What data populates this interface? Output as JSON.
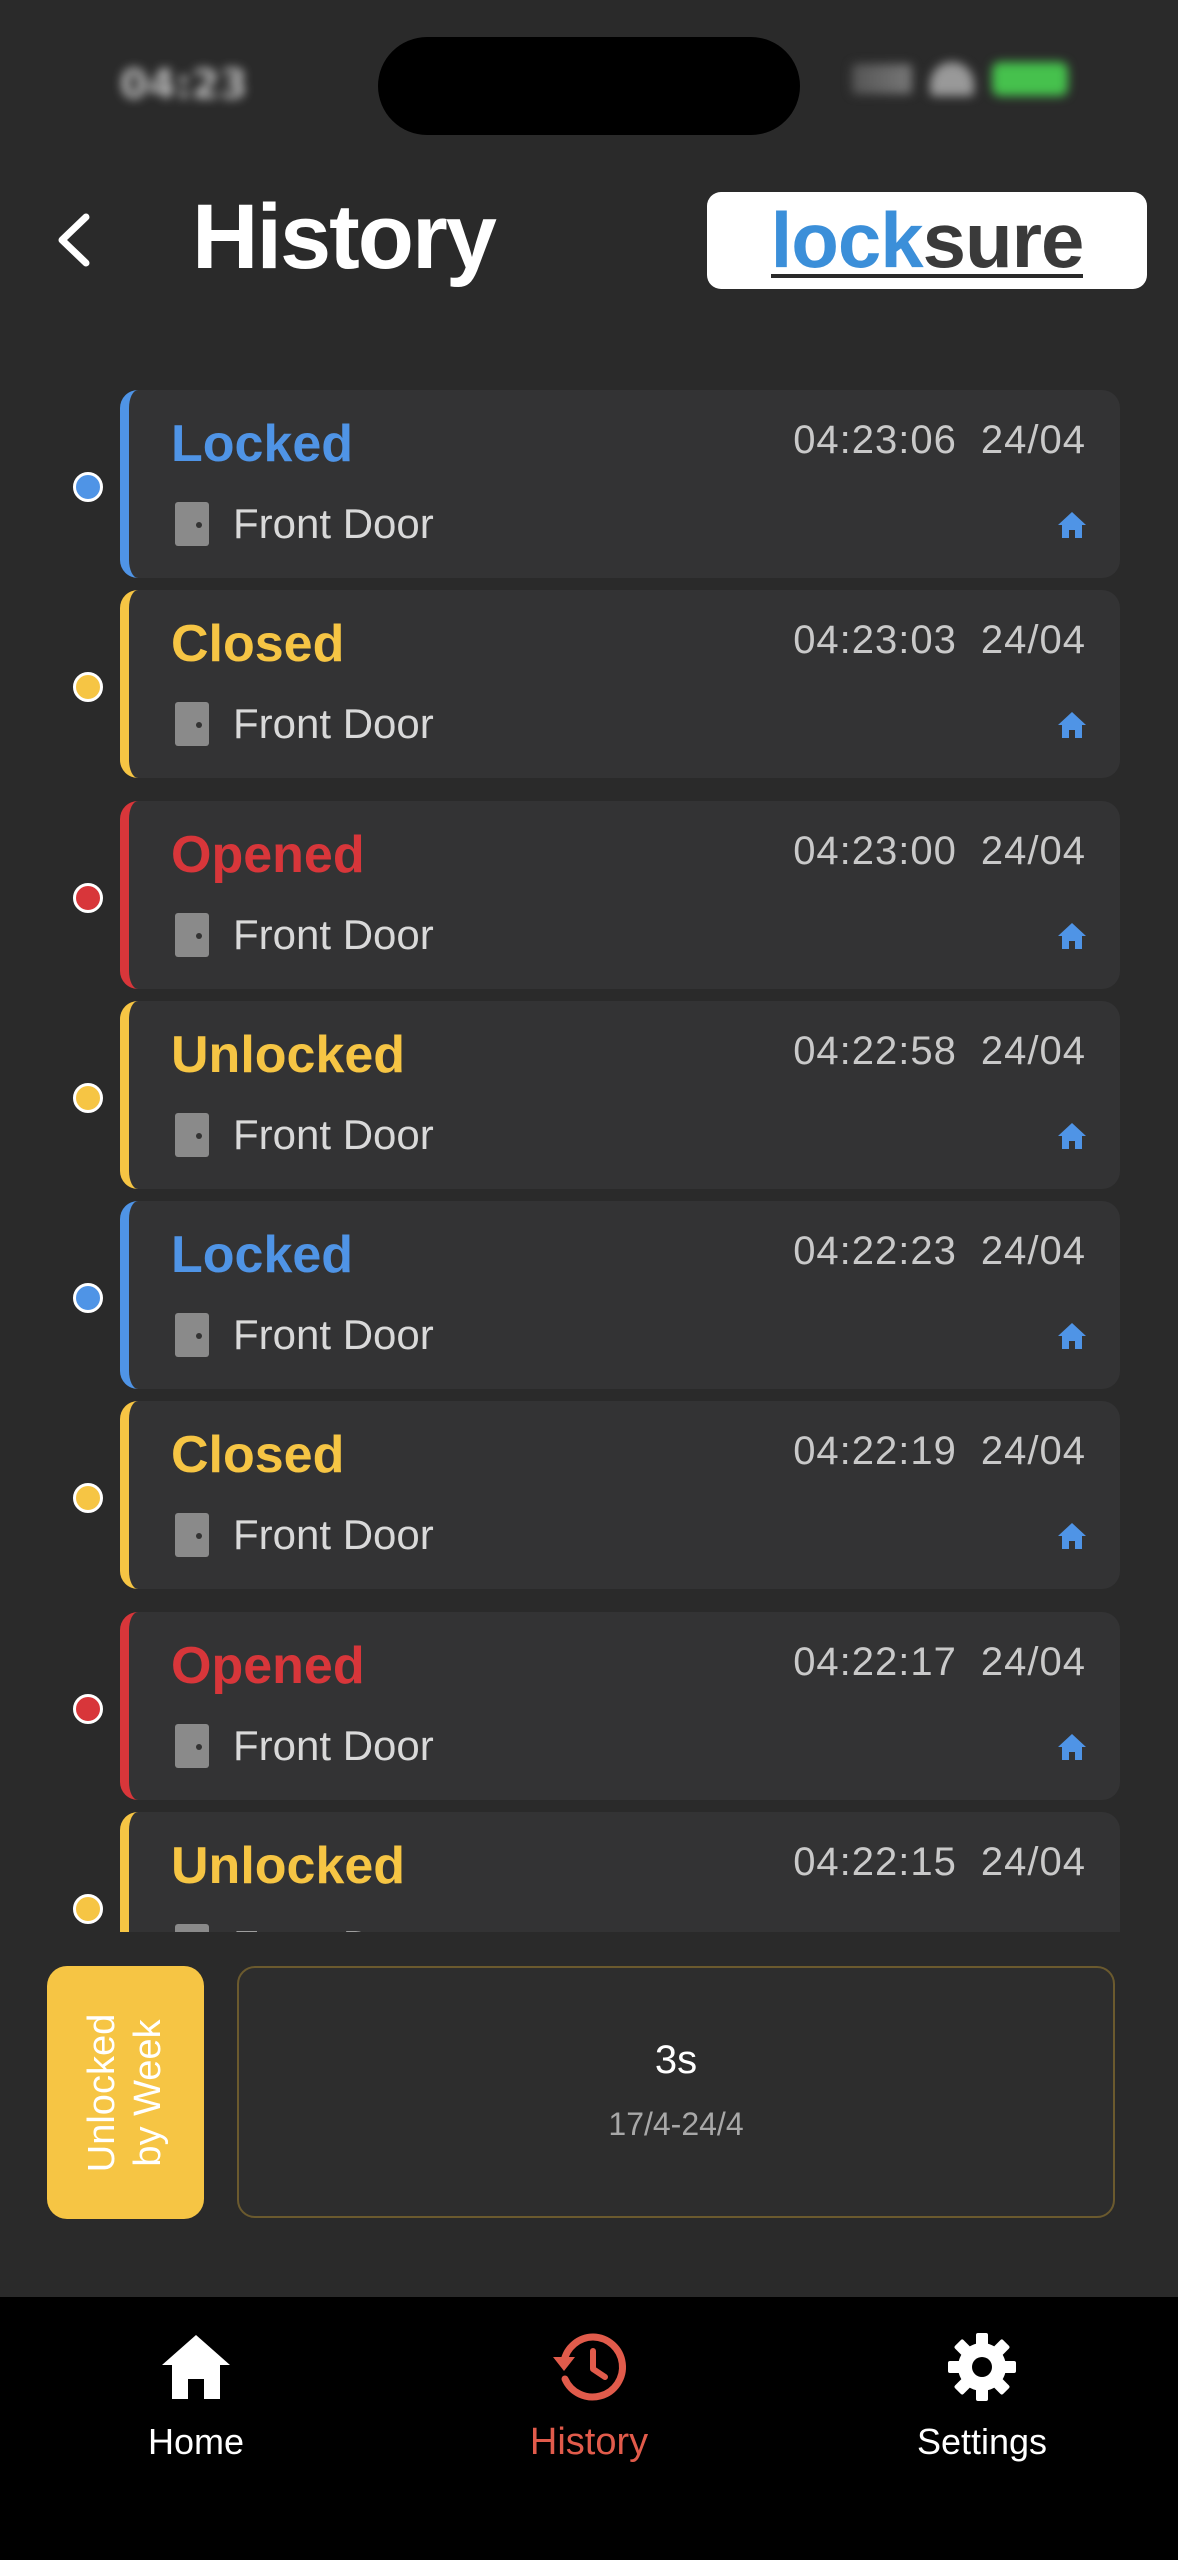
{
  "status_bar": {
    "time": "04:23"
  },
  "header": {
    "title": "History",
    "logo_text_lock": "lock",
    "logo_text_sure": "sure"
  },
  "colors": {
    "locked": "#4f94e6",
    "closed": "#f6c544",
    "opened": "#d8363a",
    "unlocked": "#f6c544",
    "accent_active": "#e15b4b"
  },
  "events": [
    {
      "status": "Locked",
      "type": "locked",
      "time": "04:23:06",
      "date": "24/04",
      "door": "Front Door"
    },
    {
      "status": "Closed",
      "type": "closed",
      "time": "04:23:03",
      "date": "24/04",
      "door": "Front Door"
    },
    {
      "status": "Opened",
      "type": "opened",
      "time": "04:23:00",
      "date": "24/04",
      "door": "Front Door"
    },
    {
      "status": "Unlocked",
      "type": "unlocked",
      "time": "04:22:58",
      "date": "24/04",
      "door": "Front Door"
    },
    {
      "status": "Locked",
      "type": "locked",
      "time": "04:22:23",
      "date": "24/04",
      "door": "Front Door"
    },
    {
      "status": "Closed",
      "type": "closed",
      "time": "04:22:19",
      "date": "24/04",
      "door": "Front Door"
    },
    {
      "status": "Opened",
      "type": "opened",
      "time": "04:22:17",
      "date": "24/04",
      "door": "Front Door"
    },
    {
      "status": "Unlocked",
      "type": "unlocked",
      "time": "04:22:15",
      "date": "24/04",
      "door": "Front Door"
    }
  ],
  "summary": {
    "tab_label": "Unlocked\nby Week",
    "value": "3s",
    "range": "17/4-24/4"
  },
  "nav": {
    "items": [
      {
        "label": "Home",
        "icon": "home-icon",
        "active": false
      },
      {
        "label": "History",
        "icon": "history-icon",
        "active": true
      },
      {
        "label": "Settings",
        "icon": "gear-icon",
        "active": false
      }
    ]
  }
}
